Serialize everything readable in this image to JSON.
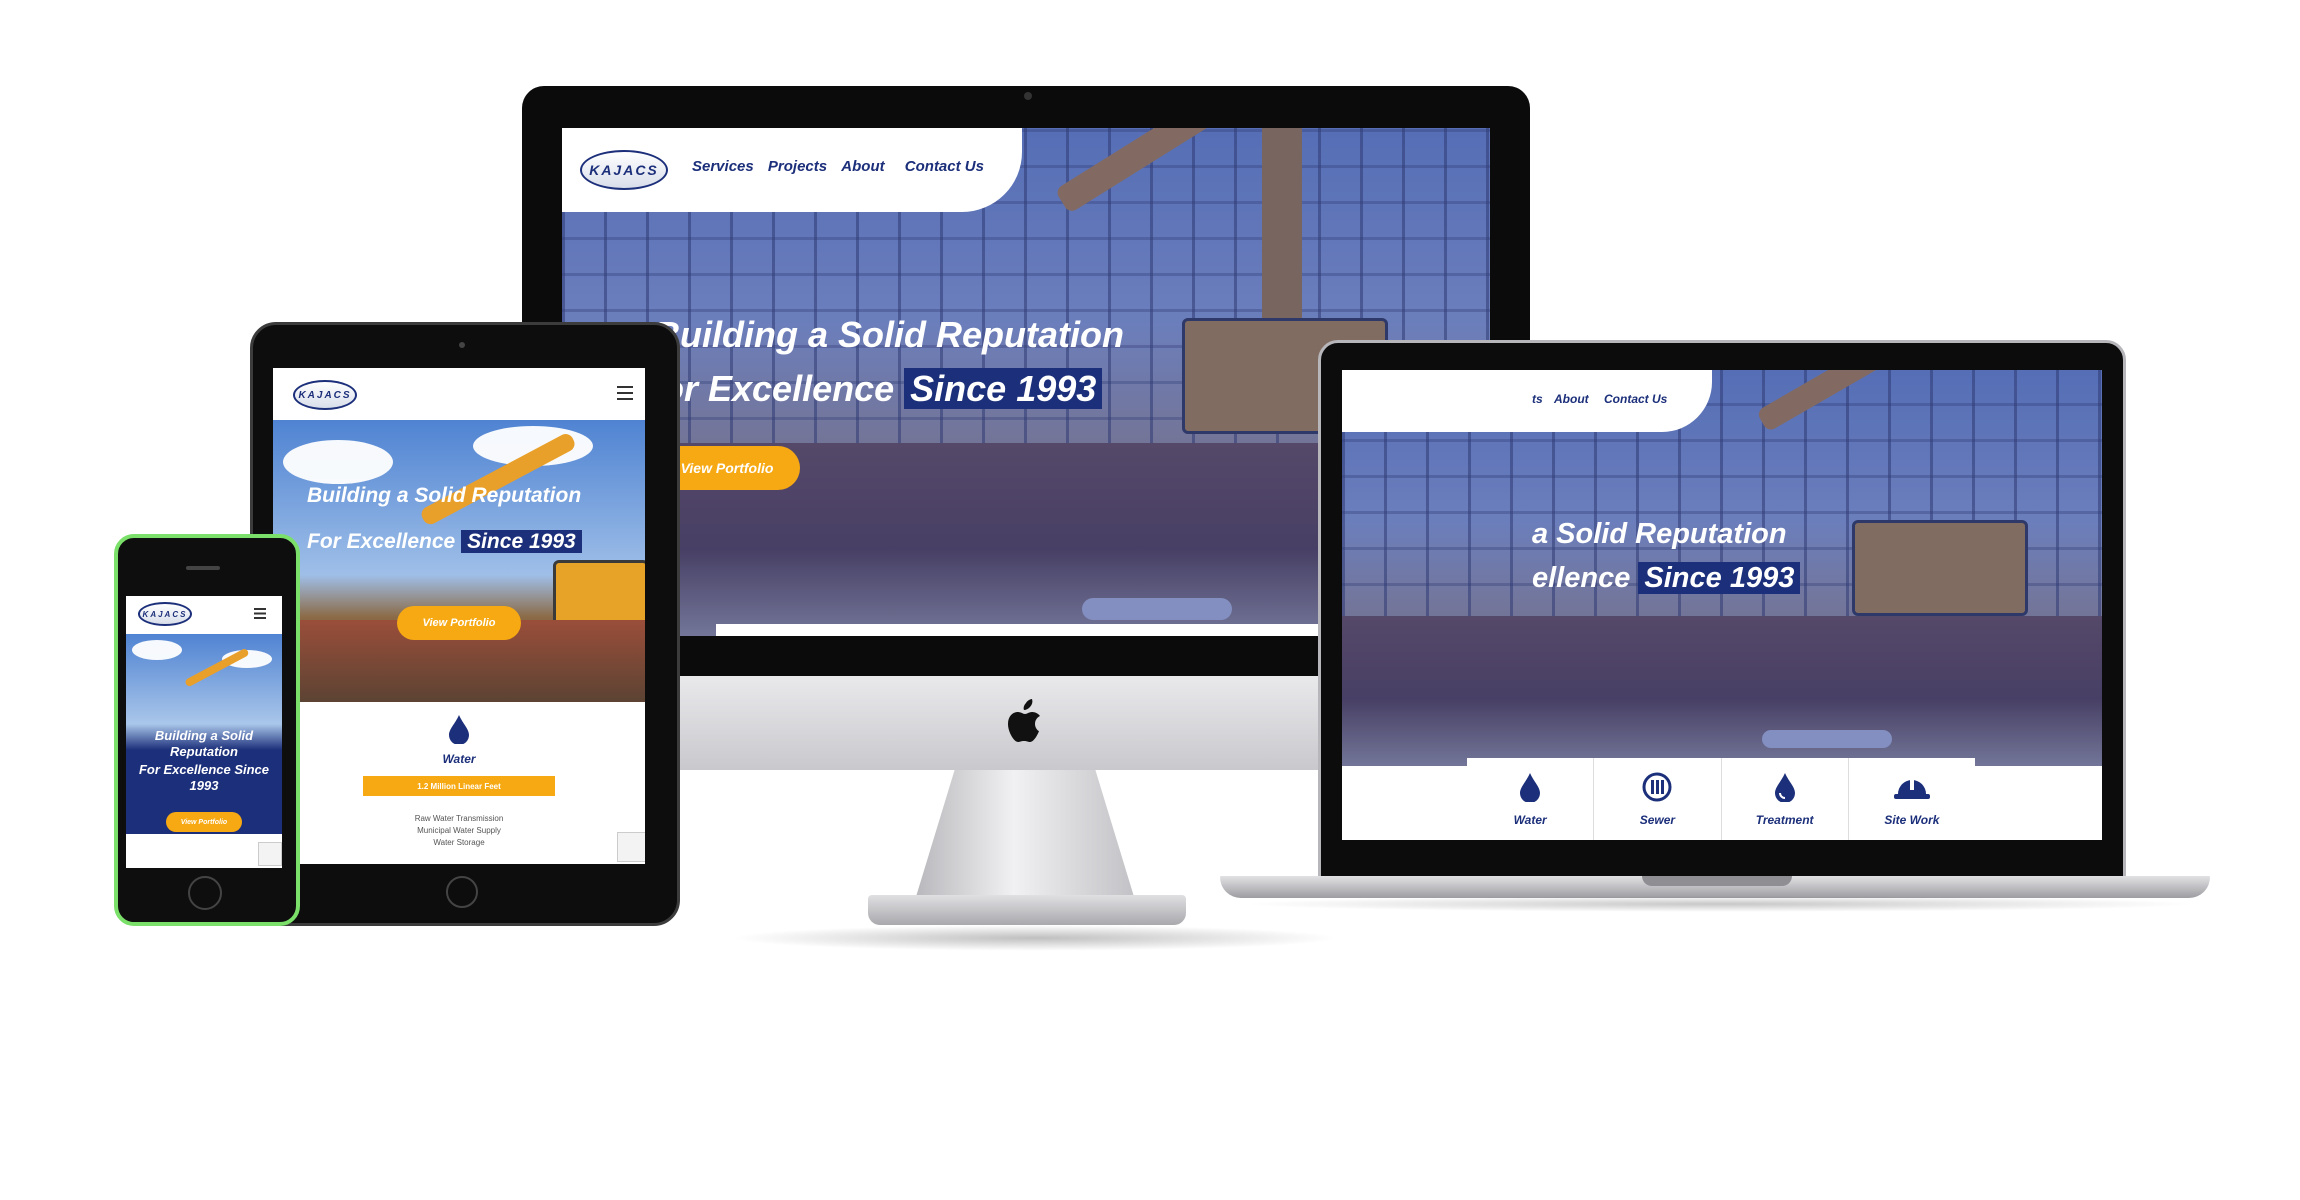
{
  "brand": {
    "logo_text": "KAJACS",
    "accent": "#f6a912",
    "navy": "#1c2f7a"
  },
  "nav": {
    "services": "Services",
    "projects": "Projects",
    "about": "About",
    "contact": "Contact Us",
    "laptop_partial": "ts"
  },
  "hero": {
    "line1": "Building a Solid Reputation",
    "line2a": "For Excellence",
    "line2b": "Since 1993",
    "desktop_line1": "Building a Solid Reputation",
    "desktop_line2a": "or Excellence",
    "laptop_line1": "a Solid Reputation",
    "laptop_line2a": "ellence",
    "phone_line1": "Building a Solid Reputation",
    "phone_line2": "For Excellence  Since 1993",
    "cta": "View Portfolio"
  },
  "services": [
    {
      "label": "Water",
      "icon": "water-drop-icon"
    },
    {
      "label": "Sewer",
      "icon": "sewer-grate-icon"
    },
    {
      "label": "Treatment",
      "icon": "treatment-drop-icon"
    },
    {
      "label": "Site Work",
      "icon": "hard-hat-icon"
    }
  ],
  "tablet_section": {
    "title": "Water",
    "badge": "1.2 Million Linear Feet",
    "items": [
      "Raw Water Transmission",
      "Municipal Water Supply",
      "Water Storage"
    ]
  }
}
